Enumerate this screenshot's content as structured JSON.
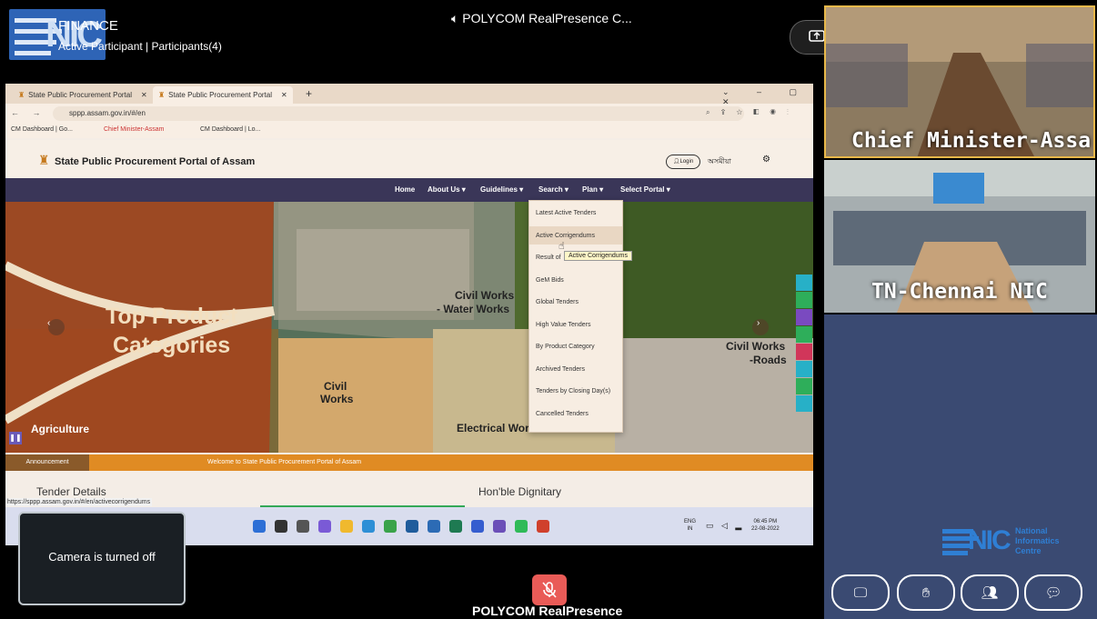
{
  "conference": {
    "logo_text": "NIC",
    "title": "FINANCE",
    "subtitle": "Active Participant  |  Participants(4)",
    "speaker_label": "POLYCOM RealPresence C...",
    "footer_label": "POLYCOM RealPresence",
    "camera_off": "Camera is turned off"
  },
  "browser": {
    "tabs": [
      {
        "label": "State Public Procurement Portal",
        "close": "✕"
      },
      {
        "label": "State Public Procurement Portal",
        "close": "✕"
      }
    ],
    "new_tab": "+",
    "url": "sppp.assam.gov.in/#/en",
    "bookmarks": [
      "CM Dashboard | Go...",
      "Chief Minister-Assam",
      "CM Dashboard | Lo..."
    ],
    "status_url": "https://sppp.assam.gov.in/#/en/activecorrigendums"
  },
  "site": {
    "title": "State Public Procurement Portal of Assam",
    "login": "Login",
    "lang": "অসমীয়া",
    "nav": [
      "Home",
      "About Us ▾",
      "Guidelines ▾",
      "Search ▾",
      "Plan ▾",
      "Select Portal ▾"
    ],
    "hero": {
      "top_product": "Top Product",
      "categories": "Categories",
      "agriculture": "Agriculture",
      "civil_works_water_1": "Civil Works",
      "civil_works_water_2": "- Water Works",
      "civil_1": "Civil",
      "civil_2": "Works",
      "electrical": "Electrical Works",
      "roads_1": "Civil Works",
      "roads_2": "-Roads"
    },
    "dropdown": [
      "Latest Active Tenders",
      "Active Corrigendums",
      "Result of",
      "GeM Bids",
      "Global Tenders",
      "High Value Tenders",
      "By Product Category",
      "Archived Tenders",
      "Tenders by Closing Day(s)",
      "Cancelled Tenders"
    ],
    "tooltip": "Active Corrigendums",
    "announcement_label": "Announcement",
    "announcement_text": "Welcome to State Public Procurement Portal of Assam",
    "tender_details": "Tender Details",
    "dignitary": "Hon'ble Dignitary"
  },
  "taskbar": {
    "lang": "ENG",
    "lang_sub": "IN",
    "time": "06:45 PM",
    "date": "22-08-2022"
  },
  "videos": {
    "top_label": "Chief Minister-Assa",
    "mid_label": "TN-Chennai NIC"
  },
  "nic_brand": {
    "logo": "NIC",
    "line1": "National",
    "line2": "Informatics",
    "line3": "Centre"
  },
  "colors": {
    "end_call": "#e23a2e",
    "panel": "#3a4a72",
    "navbar": "#3a3658",
    "announcement": "#e08b23"
  }
}
